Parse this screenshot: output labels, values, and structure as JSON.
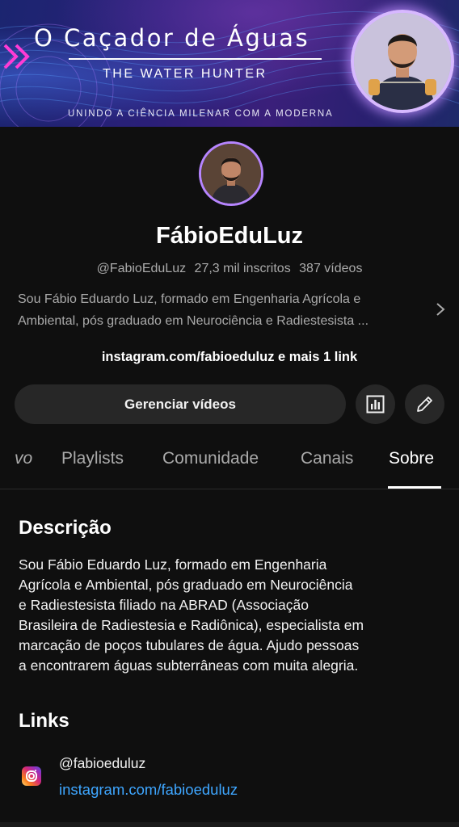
{
  "banner": {
    "title": "O Caçador de Águas",
    "subtitle": "THE WATER HUNTER",
    "tagline": "UNINDO A CIÊNCIA MILENAR COM A MODERNA"
  },
  "channel": {
    "name": "FábioEduLuz",
    "handle": "@FabioEduLuz",
    "subscribers": "27,3 mil inscritos",
    "videos": "387 vídeos",
    "bio_preview": "Sou Fábio Eduardo Luz, formado em Engenharia Agrícola e Ambiental, pós graduado em Neurociência e Radiestesista ...",
    "links_summary": "instagram.com/fabioeduluz e mais 1 link"
  },
  "actions": {
    "manage_label": "Gerenciar vídeos",
    "analytics_icon": "bar-chart-icon",
    "edit_icon": "pencil-icon"
  },
  "tabs": [
    {
      "label": "vo",
      "active": false
    },
    {
      "label": "Playlists",
      "active": false
    },
    {
      "label": "Comunidade",
      "active": false
    },
    {
      "label": "Canais",
      "active": false
    },
    {
      "label": "Sobre",
      "active": true
    }
  ],
  "about": {
    "description_title": "Descrição",
    "description_lines": [
      "Sou Fábio Eduardo Luz, formado em Engenharia",
      "Agrícola e Ambiental, pós graduado em Neurociência",
      "e Radiestesista filiado na ABRAD (Associação",
      "Brasileira de Radiestesia e Radiônica), especialista em",
      "marcação de poços tubulares de água. Ajudo pessoas",
      "a encontrarem águas subterrâneas com muita alegria."
    ],
    "links_title": "Links",
    "links": [
      {
        "title": "@fabioeduluz",
        "url": "instagram.com/fabioeduluz",
        "icon": "instagram-icon"
      }
    ]
  },
  "colors": {
    "background": "#0f0f0f",
    "surface": "#272727",
    "link": "#3ea6ff",
    "avatar_ring": "#b685ff"
  }
}
